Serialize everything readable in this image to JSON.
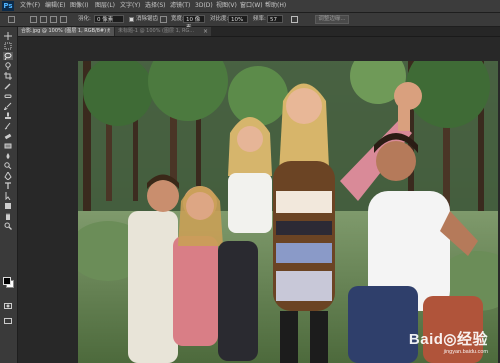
{
  "app": {
    "logo": "Ps"
  },
  "menu": [
    "文件(F)",
    "编辑(E)",
    "图像(I)",
    "图层(L)",
    "文字(Y)",
    "选择(S)",
    "滤镜(T)",
    "3D(D)",
    "视图(V)",
    "窗口(W)",
    "帮助(H)"
  ],
  "options": {
    "feather_label": "羽化:",
    "feather_value": "0 像素",
    "antialias_label": "消除锯齿",
    "width_label": "宽度:",
    "width_value": "10 像素",
    "contrast_label": "对比度:",
    "contrast_value": "10%",
    "frequency_label": "频率:",
    "frequency_value": "57",
    "refine_edge_label": "调整边缘..."
  },
  "tabs": [
    {
      "label": "合影.jpg @ 100% (图层 1, RGB/8#) *"
    },
    {
      "label": "未标题-1 @ 100% (图层 1, RG..."
    }
  ],
  "tools": [
    "move-tool",
    "marquee-tool",
    "magnetic-lasso-tool",
    "quick-selection-tool",
    "crop-tool",
    "eyedropper-tool",
    "healing-brush-tool",
    "brush-tool",
    "clone-stamp-tool",
    "history-brush-tool",
    "eraser-tool",
    "gradient-tool",
    "blur-tool",
    "dodge-tool",
    "pen-tool",
    "type-tool",
    "path-selection-tool",
    "shape-tool",
    "hand-tool",
    "zoom-tool"
  ],
  "watermark": {
    "main": "Baid◎经验",
    "url": "jingyan.baidu.com"
  },
  "colors": {
    "accent": "#4fb4ff",
    "panel": "#3a3a3a",
    "canvas_bg": "#282828"
  }
}
